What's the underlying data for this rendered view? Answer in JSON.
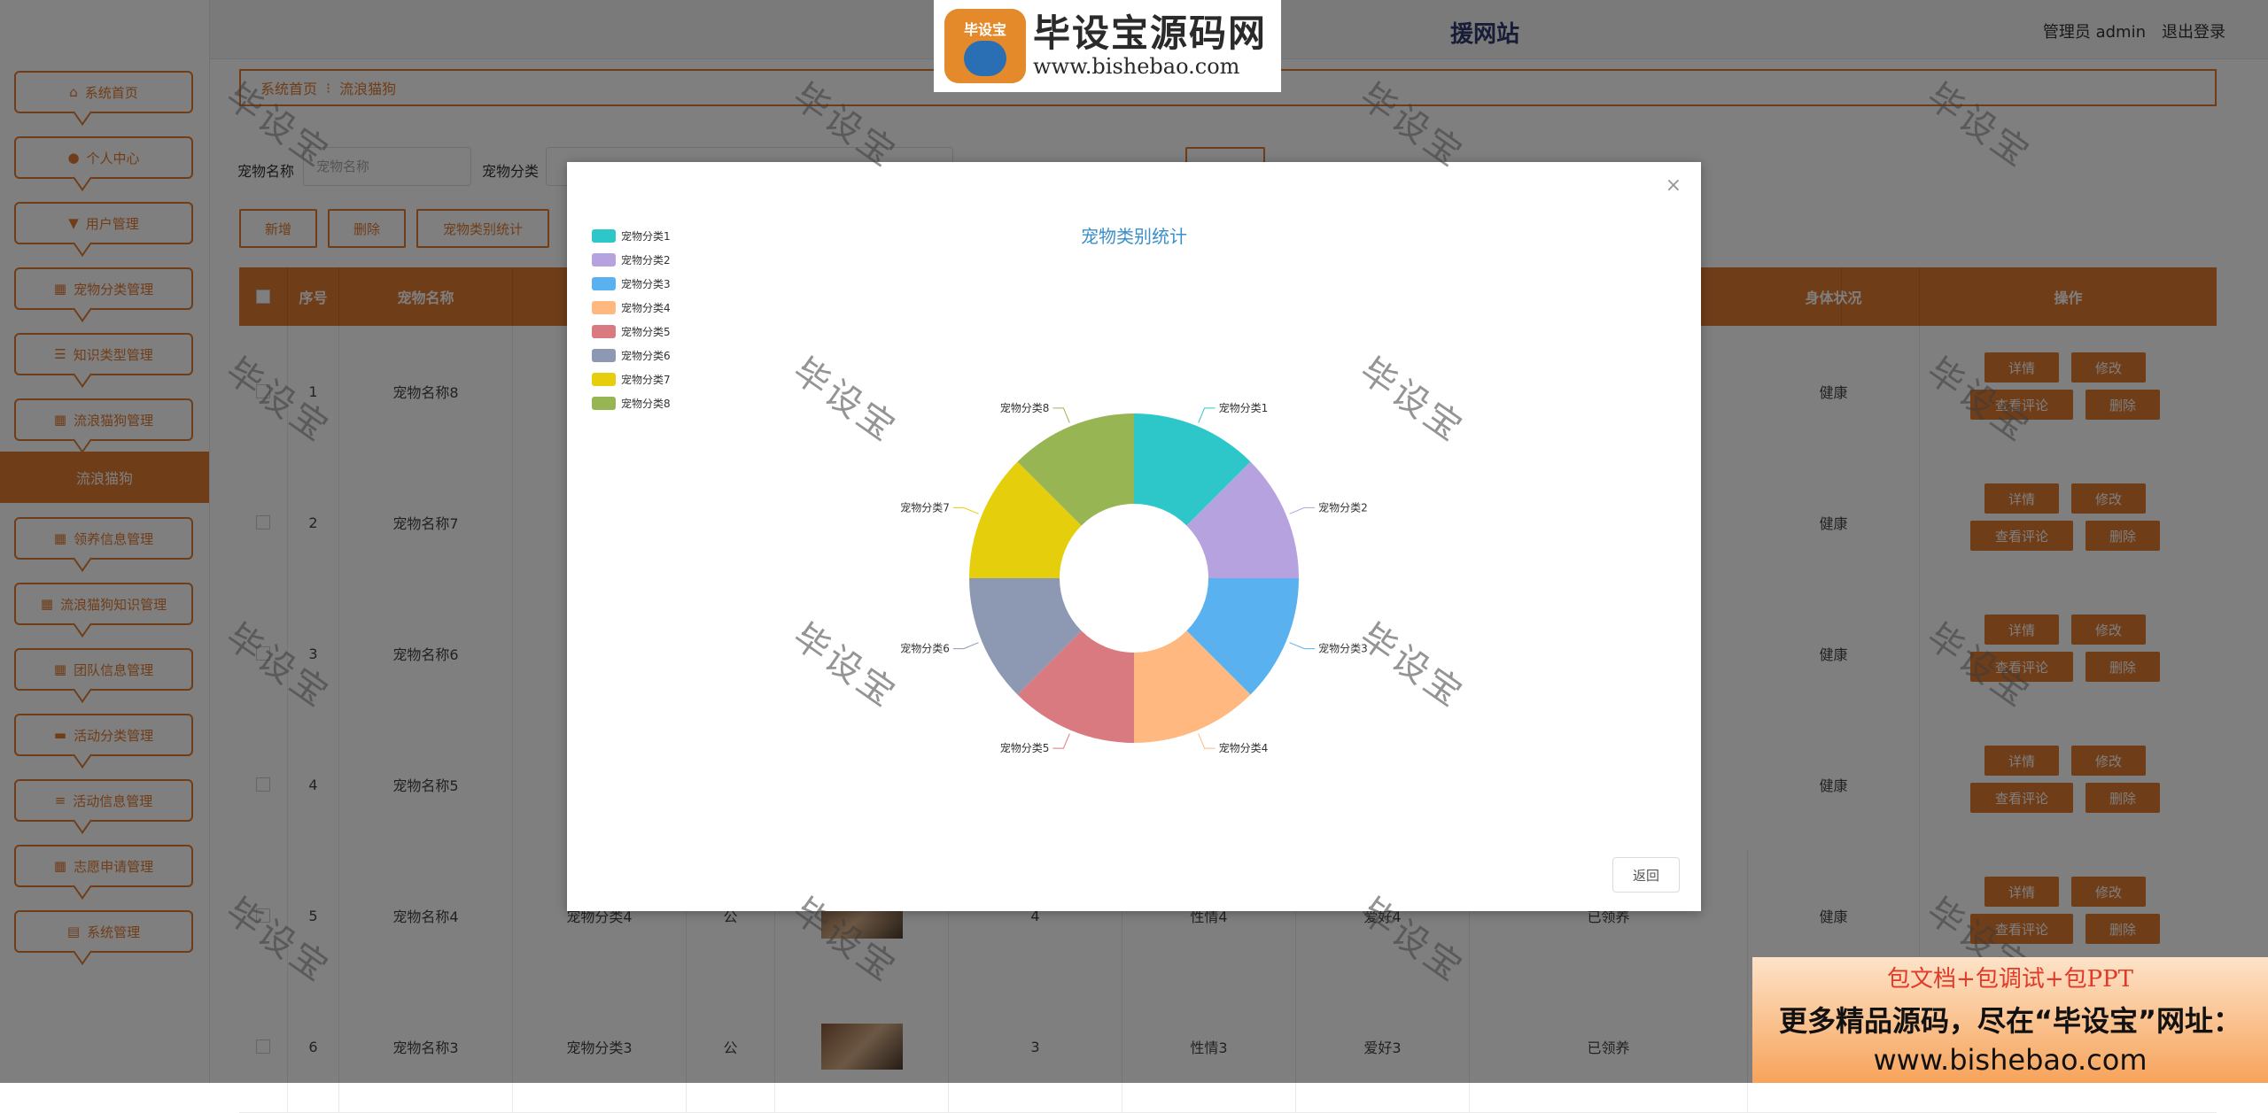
{
  "header": {
    "site_title": "援网站",
    "user_role": "管理员 admin",
    "logout": "退出登录"
  },
  "logo": {
    "badge": "毕设宝",
    "brand": "毕设宝源码网",
    "url": "www.bishebao.com"
  },
  "sidebar": {
    "items": [
      {
        "label": "系统首页",
        "icon": "home-icon"
      },
      {
        "label": "个人中心",
        "icon": "person-icon"
      },
      {
        "label": "用户管理",
        "icon": "user-manage-icon"
      },
      {
        "label": "宠物分类管理",
        "icon": "grid-icon"
      },
      {
        "label": "知识类型管理",
        "icon": "sliders-icon"
      },
      {
        "label": "流浪猫狗管理",
        "icon": "grid-icon"
      },
      {
        "label": "领养信息管理",
        "icon": "grid-icon"
      },
      {
        "label": "流浪猫狗知识管理",
        "icon": "grid-icon"
      },
      {
        "label": "团队信息管理",
        "icon": "grid-icon"
      },
      {
        "label": "活动分类管理",
        "icon": "chat-icon"
      },
      {
        "label": "活动信息管理",
        "icon": "list-icon"
      },
      {
        "label": "志愿申请管理",
        "icon": "grid-icon"
      },
      {
        "label": "系统管理",
        "icon": "doc-icon"
      }
    ],
    "active_sub": "流浪猫狗"
  },
  "breadcrumb": {
    "home": "系统首页",
    "sep": "⁝",
    "current": "流浪猫狗"
  },
  "search": {
    "name_label": "宠物名称",
    "name_placeholder": "宠物名称",
    "category_label": "宠物分类"
  },
  "toolbar": {
    "add": "新增",
    "delete": "删除",
    "stats": "宠物类别统计"
  },
  "table": {
    "headers": {
      "index": "序号",
      "pet_name": "宠物名称",
      "health": "身体状况",
      "actions": "操作"
    },
    "rows": [
      {
        "index": "1",
        "name": "宠物名称8",
        "health": "健康"
      },
      {
        "index": "2",
        "name": "宠物名称7",
        "health": "健康"
      },
      {
        "index": "3",
        "name": "宠物名称6",
        "health": "健康"
      },
      {
        "index": "4",
        "name": "宠物名称5",
        "health": "健康"
      },
      {
        "index": "5",
        "name": "宠物名称4",
        "category": "宠物分类4",
        "gender": "公",
        "age": "4",
        "temper": "性情4",
        "hobby": "爱好4",
        "status": "已领养",
        "health": "健康"
      },
      {
        "index": "6",
        "name": "宠物名称3",
        "category": "宠物分类3",
        "gender": "公",
        "age": "3",
        "temper": "性情3",
        "hobby": "爱好3",
        "status": "已领养"
      }
    ],
    "actions": {
      "detail": "详情",
      "edit": "修改",
      "comments": "查看评论",
      "delete": "删除"
    }
  },
  "modal": {
    "title": "宠物类别统计",
    "back": "返回",
    "close": "×"
  },
  "chart_data": {
    "type": "pie",
    "title": "宠物类别统计",
    "legend_position": "top-left",
    "categories": [
      "宠物分类1",
      "宠物分类2",
      "宠物分类3",
      "宠物分类4",
      "宠物分类5",
      "宠物分类6",
      "宠物分类7",
      "宠物分类8"
    ],
    "values": [
      1,
      1,
      1,
      1,
      1,
      1,
      1,
      1
    ],
    "colors": [
      "#2ec7c9",
      "#b6a2de",
      "#5ab1ef",
      "#ffb980",
      "#d87a80",
      "#8d98b3",
      "#e5cf0d",
      "#97b552"
    ]
  },
  "watermark": "毕设宝",
  "ad": {
    "line1": "包文档+包调试+包PPT",
    "line2": "更多精品源码，尽在“毕设宝”网址：",
    "line3": "www.bishebao.com"
  }
}
